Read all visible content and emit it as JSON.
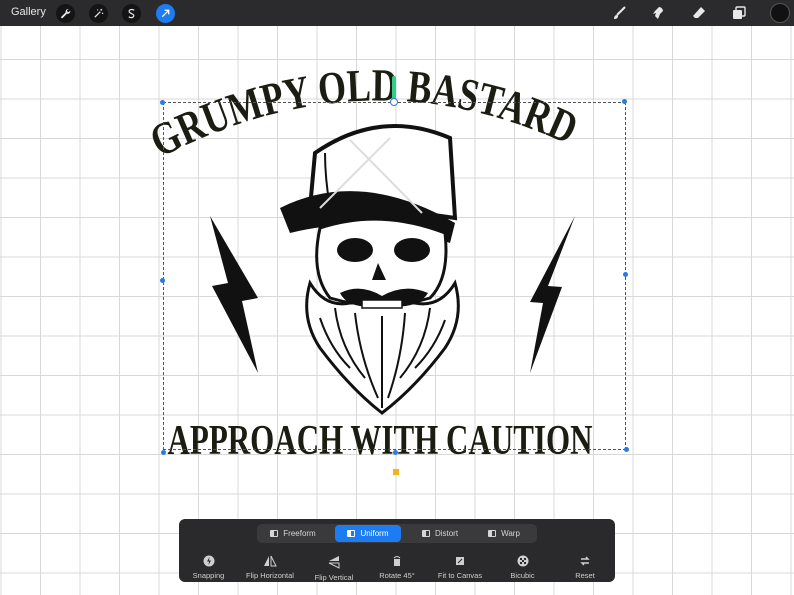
{
  "topbar": {
    "gallery_label": "Gallery",
    "left_tools": [
      "wrench-icon",
      "magic-wand-icon",
      "selection-s-icon",
      "transform-arrow-icon"
    ],
    "right_tools": [
      "brush-icon",
      "smudge-icon",
      "eraser-icon",
      "layers-icon"
    ],
    "color_swatch": "#111111"
  },
  "artwork": {
    "top_text": "GRUMPY OLD BASTARD",
    "bottom_text": "APPROACH WITH CAUTION"
  },
  "transform_toolbar": {
    "modes": [
      {
        "label": "Freeform",
        "active": false
      },
      {
        "label": "Uniform",
        "active": true
      },
      {
        "label": "Distort",
        "active": false
      },
      {
        "label": "Warp",
        "active": false
      }
    ],
    "actions": [
      {
        "label": "Snapping",
        "icon": "snapping-icon"
      },
      {
        "label": "Flip Horizontal",
        "icon": "flip-horizontal-icon"
      },
      {
        "label": "Flip Vertical",
        "icon": "flip-vertical-icon"
      },
      {
        "label": "Rotate 45°",
        "icon": "rotate-icon"
      },
      {
        "label": "Fit to Canvas",
        "icon": "fit-to-canvas-icon"
      },
      {
        "label": "Bicubic",
        "icon": "bicubic-icon"
      },
      {
        "label": "Reset",
        "icon": "reset-icon"
      }
    ]
  },
  "colors": {
    "accent": "#1e7cf2",
    "toolbar_bg": "#2a2a2c",
    "topbar_bg": "#2b2b2d"
  }
}
